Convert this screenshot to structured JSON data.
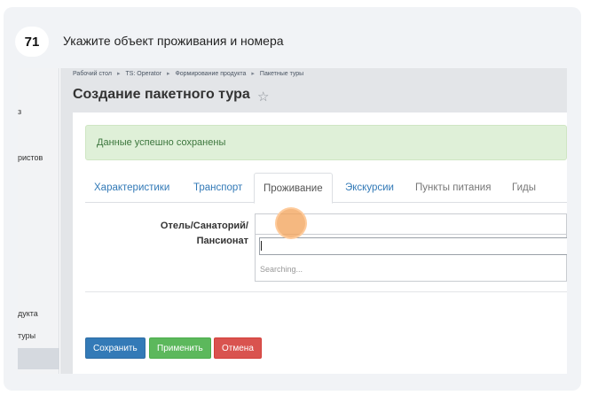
{
  "step": {
    "number": "71",
    "instruction": "Укажите объект проживания и номера"
  },
  "left_menu": {
    "items": [
      "з",
      "ристов",
      "дукта",
      "туры"
    ]
  },
  "breadcrumb": [
    "Рабочий стол",
    "TS: Operator",
    "Формирование продукта",
    "Пакетные туры"
  ],
  "breadcrumb_sep": "▸",
  "page": {
    "title": "Создание пакетного тура",
    "star_icon": "star-outline-icon"
  },
  "alert": {
    "text": "Данные успешно сохранены",
    "color": "#dff0d8"
  },
  "tabs": [
    {
      "label": "Характеристики",
      "state": "link"
    },
    {
      "label": "Транспорт",
      "state": "link"
    },
    {
      "label": "Проживание",
      "state": "active"
    },
    {
      "label": "Экскурсии",
      "state": "link"
    },
    {
      "label": "Пункты питания",
      "state": "inactive"
    },
    {
      "label": "Гиды",
      "state": "inactive"
    }
  ],
  "form": {
    "hotel_label_line1": "Отель/Санаторий/",
    "hotel_label_line2": "Пансионат",
    "hotel_value": "",
    "search_value": "",
    "searching_text": "Searching..."
  },
  "buttons": {
    "save": "Сохранить",
    "apply": "Применить",
    "cancel": "Отмена"
  },
  "colors": {
    "primary": "#337ab7",
    "success": "#5cb85c",
    "danger": "#d9534f",
    "click_marker": "#f2a45c"
  }
}
